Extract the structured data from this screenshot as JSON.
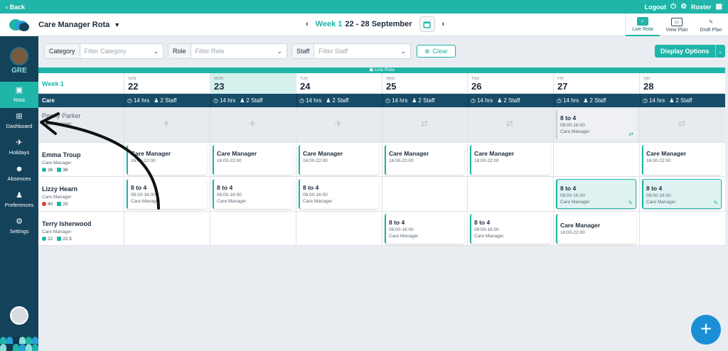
{
  "topbar": {
    "back": "Back",
    "logout": "Logout",
    "roster": "Roster"
  },
  "header": {
    "title": "Care Manager Rota",
    "week_label": "Week 1",
    "date_range": "22 - 28 September",
    "plans": [
      {
        "label": "Live Rota",
        "active": true
      },
      {
        "label": "View Plan",
        "active": false
      },
      {
        "label": "Draft Plan",
        "active": false
      }
    ]
  },
  "sidebar": {
    "org": "GRE",
    "items": [
      {
        "label": "Rota",
        "icon": "calendar-icon",
        "active": true
      },
      {
        "label": "Dashboard",
        "icon": "dashboard-icon",
        "active": false
      },
      {
        "label": "Holidays",
        "icon": "holiday-icon",
        "active": false
      },
      {
        "label": "Absences",
        "icon": "absences-icon",
        "active": false
      },
      {
        "label": "Preferences",
        "icon": "preferences-icon",
        "active": false
      },
      {
        "label": "Settings",
        "icon": "gear-icon",
        "active": false
      }
    ]
  },
  "filters": {
    "category": {
      "label": "Category",
      "placeholder": "Filter Category"
    },
    "role": {
      "label": "Role",
      "placeholder": "Filter Role"
    },
    "staff": {
      "label": "Staff",
      "placeholder": "Filter Staff"
    },
    "clear": "Clear",
    "display_options": "Display Options"
  },
  "rota": {
    "banner": "Live Rota",
    "week_label": "Week 1",
    "group": "Care",
    "days": [
      {
        "name": "SUN",
        "date": "22",
        "hrs": "14 hrs",
        "staff": "2 Staff"
      },
      {
        "name": "MON",
        "date": "23",
        "hrs": "14 hrs",
        "staff": "2 Staff"
      },
      {
        "name": "TUE",
        "date": "24",
        "hrs": "14 hrs",
        "staff": "2 Staff"
      },
      {
        "name": "WED",
        "date": "25",
        "hrs": "14 hrs",
        "staff": "2 Staff"
      },
      {
        "name": "THU",
        "date": "26",
        "hrs": "14 hrs",
        "staff": "2 Staff"
      },
      {
        "name": "FRI",
        "date": "27",
        "hrs": "14 hrs",
        "staff": "2 Staff"
      },
      {
        "name": "SAT",
        "date": "28",
        "hrs": "14 hrs",
        "staff": "2 Staff"
      }
    ],
    "employees": [
      {
        "name": "Penny Parker",
        "role": "Care Manager",
        "hours": [
          "",
          ""
        ]
      },
      {
        "name": "Emma Troup",
        "role": "Care Manager",
        "hours": [
          "36",
          "36"
        ]
      },
      {
        "name": "Lizzy Hearn",
        "role": "Care Manager",
        "hours": [
          "40",
          "20"
        ]
      },
      {
        "name": "Terry Isherwood",
        "role": "Care Manager",
        "hours": [
          "22",
          "22.5"
        ]
      }
    ],
    "shifts": {
      "penny_fri": {
        "title": "8 to 4",
        "time": "08:00-16:00",
        "role": "Care Manager"
      },
      "emma_sun": {
        "title": "Care Manager",
        "time": "16:00-22:00"
      },
      "emma_mon": {
        "title": "Care Manager",
        "time": "16:00-22:00"
      },
      "emma_tue": {
        "title": "Care Manager",
        "time": "16:00-22:00"
      },
      "emma_wed": {
        "title": "Care Manager",
        "time": "16:00-22:00"
      },
      "emma_thu": {
        "title": "Care Manager",
        "time": "16:00-22:00"
      },
      "emma_sat": {
        "title": "Care Manager",
        "time": "16:00-22:00"
      },
      "lizzy_sun": {
        "title": "8 to 4",
        "time": "08:00-16:00",
        "role": "Care Manager"
      },
      "lizzy_mon": {
        "title": "8 to 4",
        "time": "08:00-16:00",
        "role": "Care Manager"
      },
      "lizzy_tue": {
        "title": "8 to 4",
        "time": "08:00-16:00",
        "role": "Care Manager"
      },
      "lizzy_fri": {
        "title": "8 to 4",
        "time": "08:00-16:00",
        "role": "Care Manager"
      },
      "lizzy_sat": {
        "title": "8 to 4",
        "time": "08:00-16:00",
        "role": "Care Manager"
      },
      "terry_wed": {
        "title": "8 to 4",
        "time": "08:00-16:00",
        "role": "Care Manager"
      },
      "terry_thu": {
        "title": "8 to 4",
        "time": "08:00-16:00",
        "role": "Care Manager"
      },
      "terry_fri": {
        "title": "Care Manager",
        "time": "16:00-22:00"
      }
    }
  },
  "colors": {
    "accent": "#1fb5a8",
    "navy": "#14425a",
    "fab": "#1b8fd6",
    "warn": "#e53935"
  }
}
